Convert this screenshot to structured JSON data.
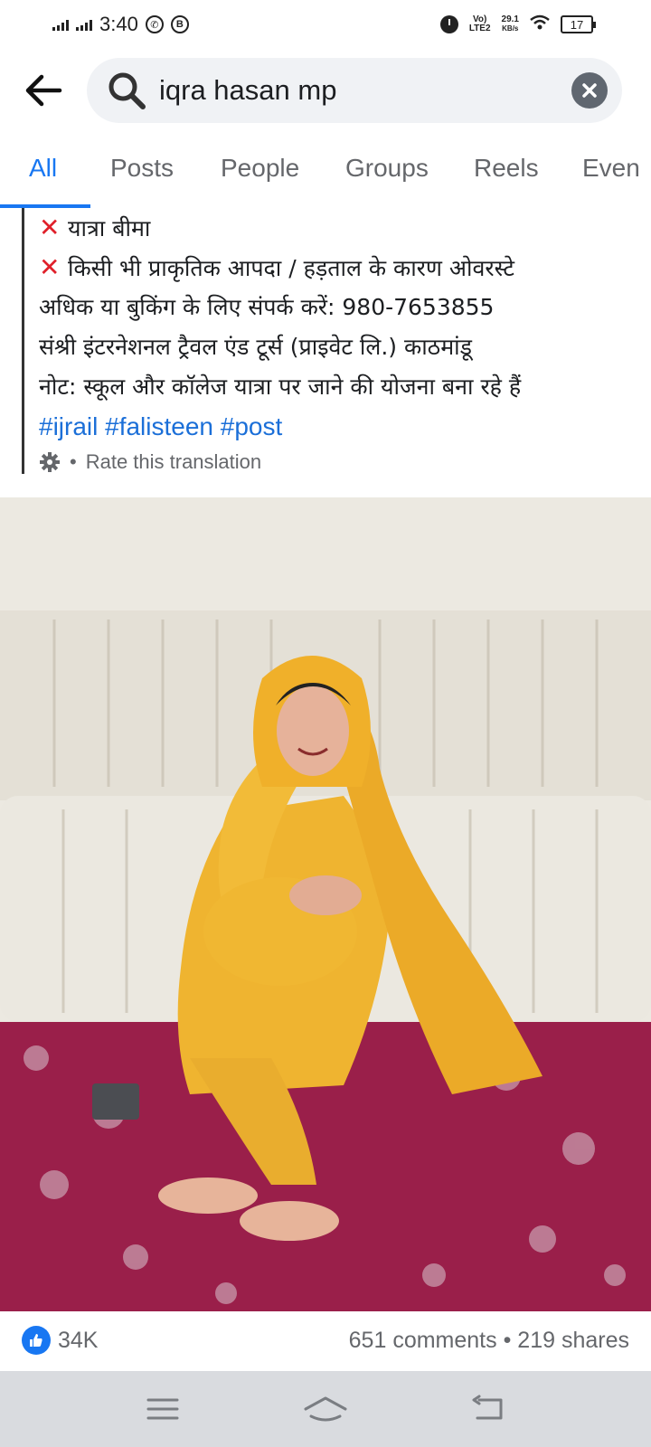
{
  "status_bar": {
    "time": "3:40",
    "whatsapp_icon": "whatsapp-icon",
    "b_icon": "b-badge-icon",
    "alarm_icon": "alarm-icon",
    "network_top": "Vo)",
    "network_bottom": "LTE2",
    "speed_value": "29.1",
    "speed_unit": "KB/s",
    "battery": "17"
  },
  "search": {
    "query": "iqra hasan mp",
    "back_icon": "arrow-left-icon",
    "search_icon": "magnifier-icon",
    "clear_icon": "close-icon"
  },
  "tabs": [
    {
      "label": "All",
      "active": true
    },
    {
      "label": "Posts",
      "active": false
    },
    {
      "label": "People",
      "active": false
    },
    {
      "label": "Groups",
      "active": false
    },
    {
      "label": "Reels",
      "active": false
    },
    {
      "label": "Even",
      "active": false
    }
  ],
  "post": {
    "lines": [
      "यात्रा बीमा",
      "किसी भी प्राकृतिक आपदा / हड़ताल के कारण ओवरस्टे",
      "अधिक या बुकिंग के लिए संपर्क करें: 980-7653855",
      "संश्री इंटरनेशनल ट्रैवल एंड टूर्स (प्राइवेट लि.) काठमांडू",
      "नोट: स्कूल और कॉलेज यात्रा पर जाने की योजना बना रहे हैं"
    ],
    "cross_icon": "red-cross-icon",
    "hashtags": "#ijrail #falisteen #post",
    "rate_translation": "Rate this translation",
    "rate_separator": "•"
  },
  "reactions": {
    "like_icon": "thumbs-up-icon",
    "like_count": "34K",
    "comments": "651 comments",
    "separator": "•",
    "shares": "219 shares"
  },
  "navigation": {
    "menu_icon": "menu-icon",
    "home_icon": "home-icon",
    "back_icon": "back-icon"
  },
  "colors": {
    "accent": "#1877f2",
    "cross": "#e0202a",
    "hashtag": "#1b6fd8"
  }
}
